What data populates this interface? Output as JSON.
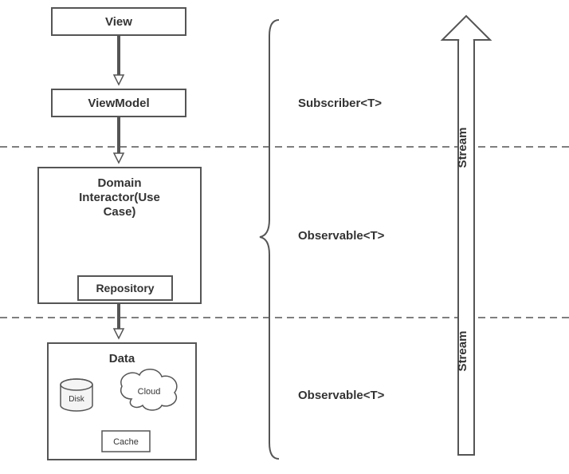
{
  "boxes": {
    "view": "View",
    "viewmodel": "ViewModel",
    "domain_line1": "Domain",
    "domain_line2": "Interactor(Use",
    "domain_line3": "Case)",
    "repository": "Repository",
    "data": "Data",
    "disk": "Disk",
    "cloud": "Cloud",
    "cache": "Cache"
  },
  "labels": {
    "subscriber": "Subscriber<T>",
    "observable1": "Observable<T>",
    "observable2": "Observable<T>",
    "stream_top": "Stream",
    "stream_bottom": "Stream"
  },
  "chart_data": {
    "type": "diagram",
    "title": "MVVM / Clean Architecture data flow with RxJava streams",
    "left_column_nodes": [
      {
        "id": "view",
        "label": "View"
      },
      {
        "id": "viewmodel",
        "label": "ViewModel"
      },
      {
        "id": "domain",
        "label": "Domain Interactor(Use Case)",
        "contains": [
          "repository"
        ]
      },
      {
        "id": "repository",
        "label": "Repository"
      },
      {
        "id": "data",
        "label": "Data",
        "contains": [
          "disk",
          "cloud",
          "cache"
        ]
      }
    ],
    "left_column_arrows": [
      {
        "from": "view",
        "to": "viewmodel"
      },
      {
        "from": "viewmodel",
        "to": "domain"
      },
      {
        "from": "repository",
        "to": "data"
      }
    ],
    "layer_dividers": [
      "between viewmodel and domain",
      "between domain and data"
    ],
    "right_labels_by_layer": [
      {
        "layer": "presentation",
        "text": "Subscriber<T>"
      },
      {
        "layer": "domain",
        "text": "Observable<T>"
      },
      {
        "layer": "data",
        "text": "Observable<T>"
      }
    ],
    "stream_arrow": {
      "direction": "up",
      "labels": [
        "Stream",
        "Stream"
      ]
    }
  }
}
